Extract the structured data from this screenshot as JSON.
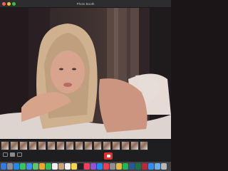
{
  "window": {
    "title": "Photo Booth"
  },
  "filmstrip": {
    "thumbnail_count": 16
  },
  "controls": {
    "view_modes": [
      "burst",
      "single",
      "video"
    ],
    "active_view_mode": "single"
  },
  "dock": {
    "apps": [
      {
        "name": "finder-icon",
        "color": "#2f7de1"
      },
      {
        "name": "launchpad-icon",
        "color": "#8e8e93"
      },
      {
        "name": "safari-icon",
        "color": "#1c8cf0"
      },
      {
        "name": "messages-icon",
        "color": "#34c759"
      },
      {
        "name": "mail-icon",
        "color": "#3a8ef6"
      },
      {
        "name": "maps-icon",
        "color": "#5ac86b"
      },
      {
        "name": "photos-icon",
        "color": "#f5a623"
      },
      {
        "name": "facetime-icon",
        "color": "#2fbf5a"
      },
      {
        "name": "calendar-icon",
        "color": "#f2f2f2"
      },
      {
        "name": "contacts-icon",
        "color": "#c8a37a"
      },
      {
        "name": "reminders-icon",
        "color": "#f0f0f0"
      },
      {
        "name": "notes-icon",
        "color": "#f7d64a"
      },
      {
        "name": "tv-icon",
        "color": "#222222"
      },
      {
        "name": "music-icon",
        "color": "#fa3c5a"
      },
      {
        "name": "podcasts-icon",
        "color": "#9b4fd6"
      },
      {
        "name": "app-store-icon",
        "color": "#1a8cf5"
      },
      {
        "name": "news-icon",
        "color": "#f23d4f"
      },
      {
        "name": "system-preferences-icon",
        "color": "#8e8e93"
      },
      {
        "name": "chrome-icon",
        "color": "#e9b93a"
      },
      {
        "name": "spotify-icon",
        "color": "#1db954"
      },
      {
        "name": "word-icon",
        "color": "#2b5797"
      },
      {
        "name": "excel-icon",
        "color": "#1e7145"
      },
      {
        "name": "photo-booth-icon",
        "color": "#c2262e"
      },
      {
        "name": "zoom-icon",
        "color": "#2d8cff"
      },
      {
        "name": "preview-icon",
        "color": "#6ab0e8"
      },
      {
        "name": "trash-icon",
        "color": "#b8b8b8"
      }
    ]
  }
}
